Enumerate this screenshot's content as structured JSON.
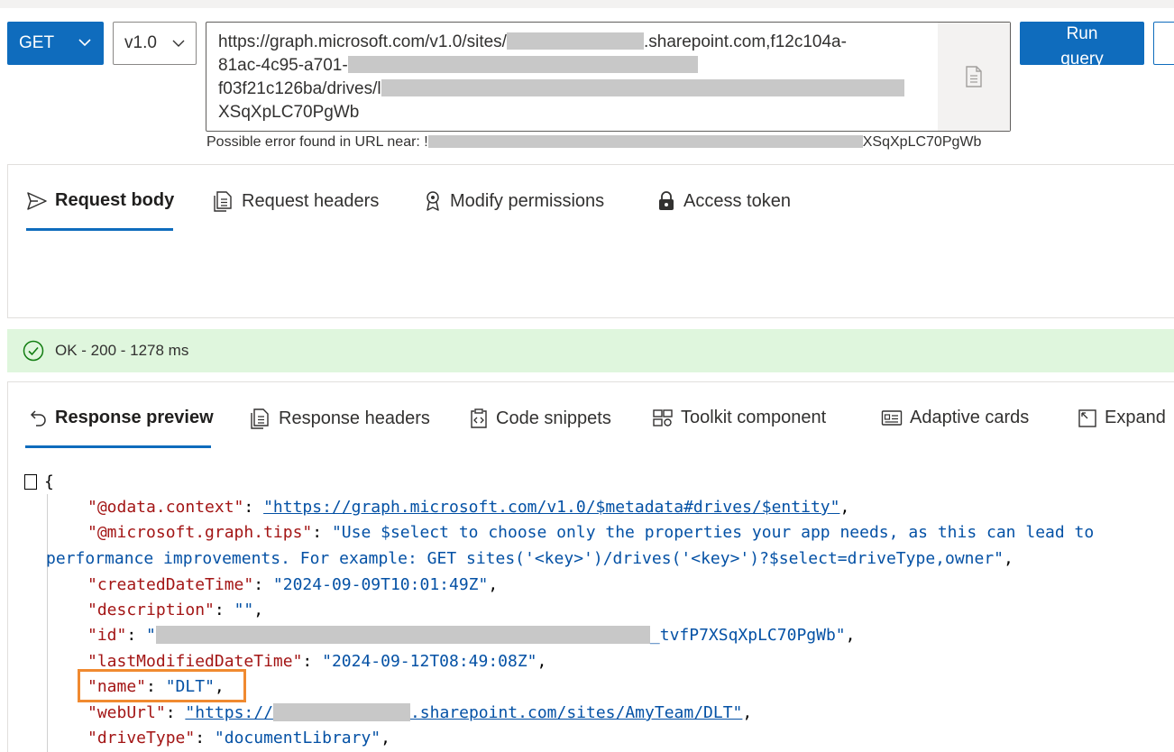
{
  "query": {
    "method": "GET",
    "version": "v1.0",
    "url_lines": [
      "https://graph.microsoft.com/v1.0/sites/",
      ".sharepoint.com,f12c104a-",
      "81ac-4c95-a701-",
      "f03f21c126ba/drives/l",
      "XSqXpLC70PgWb"
    ],
    "url_error_prefix": "Possible error found in URL near: !",
    "url_error_suffix": "XSqXpLC70PgWb",
    "run_label": "Run query"
  },
  "request_tabs": [
    {
      "label": "Request body",
      "icon": "send-icon"
    },
    {
      "label": "Request headers",
      "icon": "headers-doc-icon"
    },
    {
      "label": "Modify permissions",
      "icon": "permissions-icon"
    },
    {
      "label": "Access token",
      "icon": "lock-icon"
    }
  ],
  "status": {
    "text": "OK - 200 - 1278 ms",
    "color": "#dff6dd",
    "icon": "check-circle-icon"
  },
  "response_tabs": [
    {
      "label": "Response preview",
      "icon": "undo-arrow-icon"
    },
    {
      "label": "Response headers",
      "icon": "headers-doc-icon"
    },
    {
      "label": "Code snippets",
      "icon": "code-clipboard-icon"
    },
    {
      "label": "Toolkit component",
      "icon": "toolkit-icon"
    },
    {
      "label": "Adaptive cards",
      "icon": "card-icon"
    },
    {
      "label": "Expand",
      "icon": "expand-icon"
    }
  ],
  "json_lines": {
    "open_brace": "{",
    "context_key": "\"@odata.context\"",
    "context_val": "\"https://graph.microsoft.com/v1.0/$metadata#drives/$entity\"",
    "tips_key": "\"@microsoft.graph.tips\"",
    "tips_val_1": "\"Use $select to choose only the properties your app needs, as this can lead to",
    "tips_val_2": "performance improvements. For example: GET sites('<key>')/drives('<key>')?$select=driveType,owner\"",
    "created_key": "\"createdDateTime\"",
    "created_val": "\"2024-09-09T10:01:49Z\"",
    "desc_key": "\"description\"",
    "desc_val": "\"\"",
    "id_key": "\"id\"",
    "id_val_start": "\"",
    "id_val_end": "_tvfP7XSqXpLC70PgWb\"",
    "modified_key": "\"lastModifiedDateTime\"",
    "modified_val": "\"2024-09-12T08:49:08Z\"",
    "name_key": "\"name\"",
    "name_val": "\"DLT\"",
    "weburl_key": "\"webUrl\"",
    "weburl_val_start": "\"https://",
    "weburl_val_end": ".sharepoint.com/sites/AmyTeam/DLT\"",
    "drivetype_key": "\"driveType\"",
    "drivetype_val": "\"documentLibrary\""
  },
  "colors": {
    "accent": "#0f6cbd",
    "json_key": "#a31515",
    "json_string": "#0451a5",
    "highlight_box": "#f08a30"
  }
}
